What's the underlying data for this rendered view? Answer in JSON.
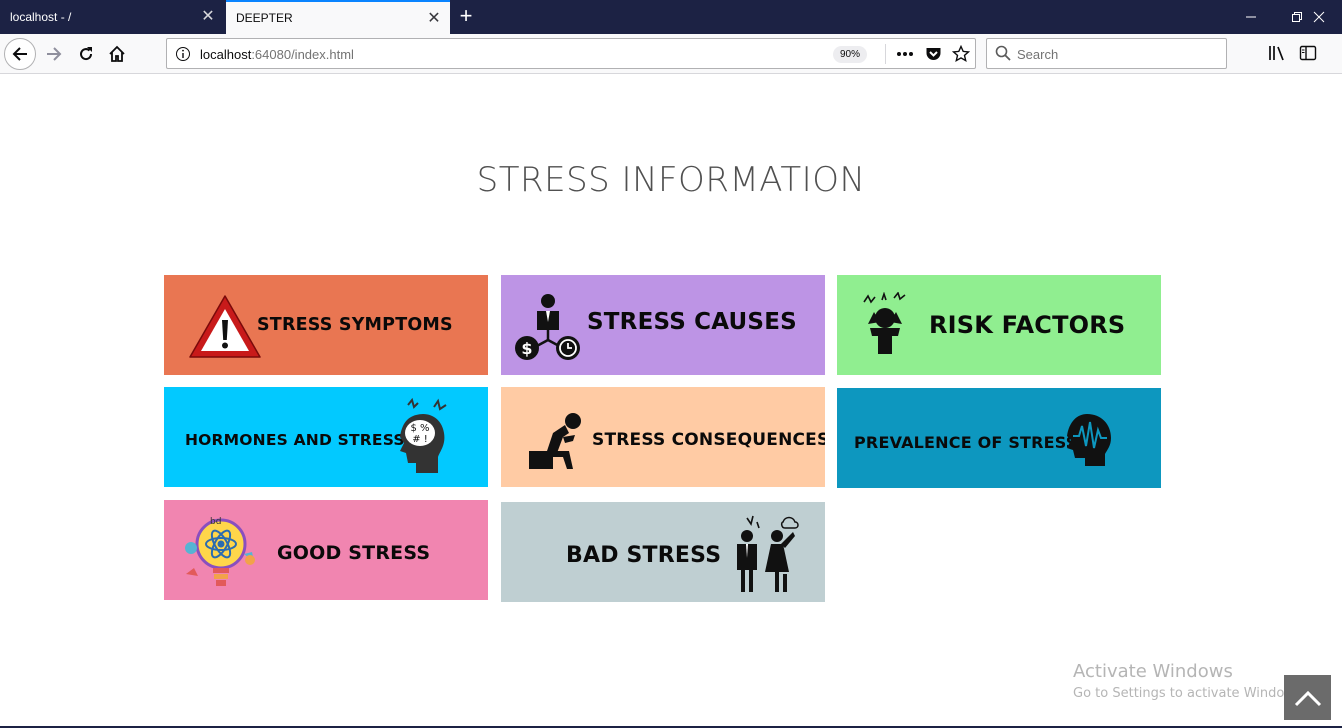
{
  "browser": {
    "tabs": [
      {
        "title": "localhost - /",
        "active": false
      },
      {
        "title": "DEEPTER",
        "active": true
      }
    ],
    "url_host": "localhost",
    "url_rest": ":64080/index.html",
    "zoom": "90%",
    "search_placeholder": "Search"
  },
  "page": {
    "title": "STRESS INFORMATION",
    "cards": [
      {
        "label": "STRESS SYMPTOMS",
        "color": "#e97652",
        "icon": "warning-icon"
      },
      {
        "label": "STRESS CAUSES",
        "color": "#bd94e5",
        "icon": "business-stress-icon"
      },
      {
        "label": "RISK FACTORS",
        "color": "#90ee90",
        "icon": "head-pain-icon"
      },
      {
        "label": "HORMONES AND STRESS",
        "color": "#02c9ff",
        "icon": "brain-head-icon"
      },
      {
        "label": "STRESS CONSEQUENCES",
        "color": "#ffcba4",
        "icon": "depressed-person-icon"
      },
      {
        "label": "PREVALENCE OF STRESS",
        "color": "#0d97bf",
        "icon": "brainwave-head-icon"
      },
      {
        "label": "GOOD STRESS",
        "color": "#f185b0",
        "icon": "lightbulb-icon"
      },
      {
        "label": "BAD STRESS",
        "color": "#bfcfd2",
        "icon": "arguing-people-icon"
      }
    ]
  },
  "watermark": {
    "title": "Activate Windows",
    "subtitle": "Go to Settings to activate Windows."
  }
}
